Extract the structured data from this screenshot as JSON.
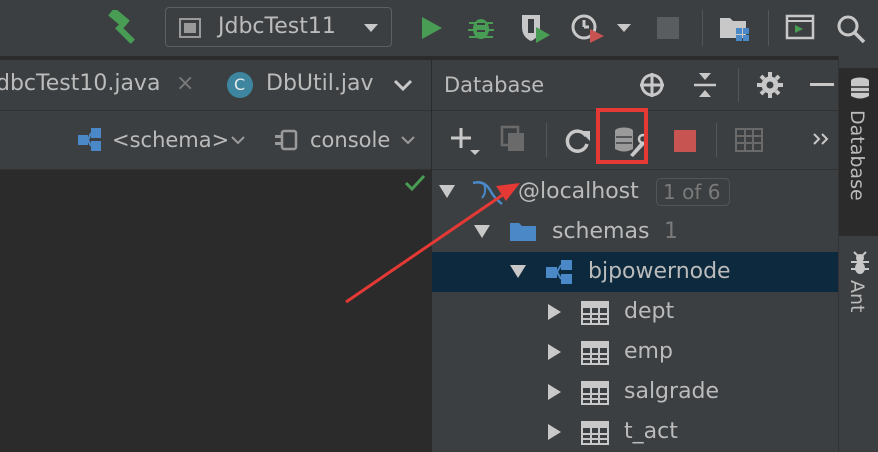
{
  "toolbar": {
    "run_config_label": "JdbcTest11"
  },
  "editor": {
    "tabs": [
      {
        "label": "dbcTest10.java",
        "close": "×"
      },
      {
        "label": "DbUtil.jav",
        "badge": "C"
      }
    ],
    "schema_label": "<schema>",
    "console_label": "console"
  },
  "db_panel": {
    "title": "Database",
    "tree": {
      "connection": {
        "label": "@localhost",
        "badge": "1 of 6"
      },
      "schemas": {
        "label": "schemas",
        "count": "1"
      },
      "schema": {
        "label": "bjpowernode"
      },
      "tables": [
        "dept",
        "emp",
        "salgrade",
        "t_act"
      ]
    }
  },
  "side_tabs": [
    "Database",
    "Ant"
  ],
  "colors": {
    "accent_red_annotation": "#e53935",
    "selection_bg": "#0d293e",
    "run_green": "#499c54",
    "folder_blue": "#4a88c7"
  }
}
